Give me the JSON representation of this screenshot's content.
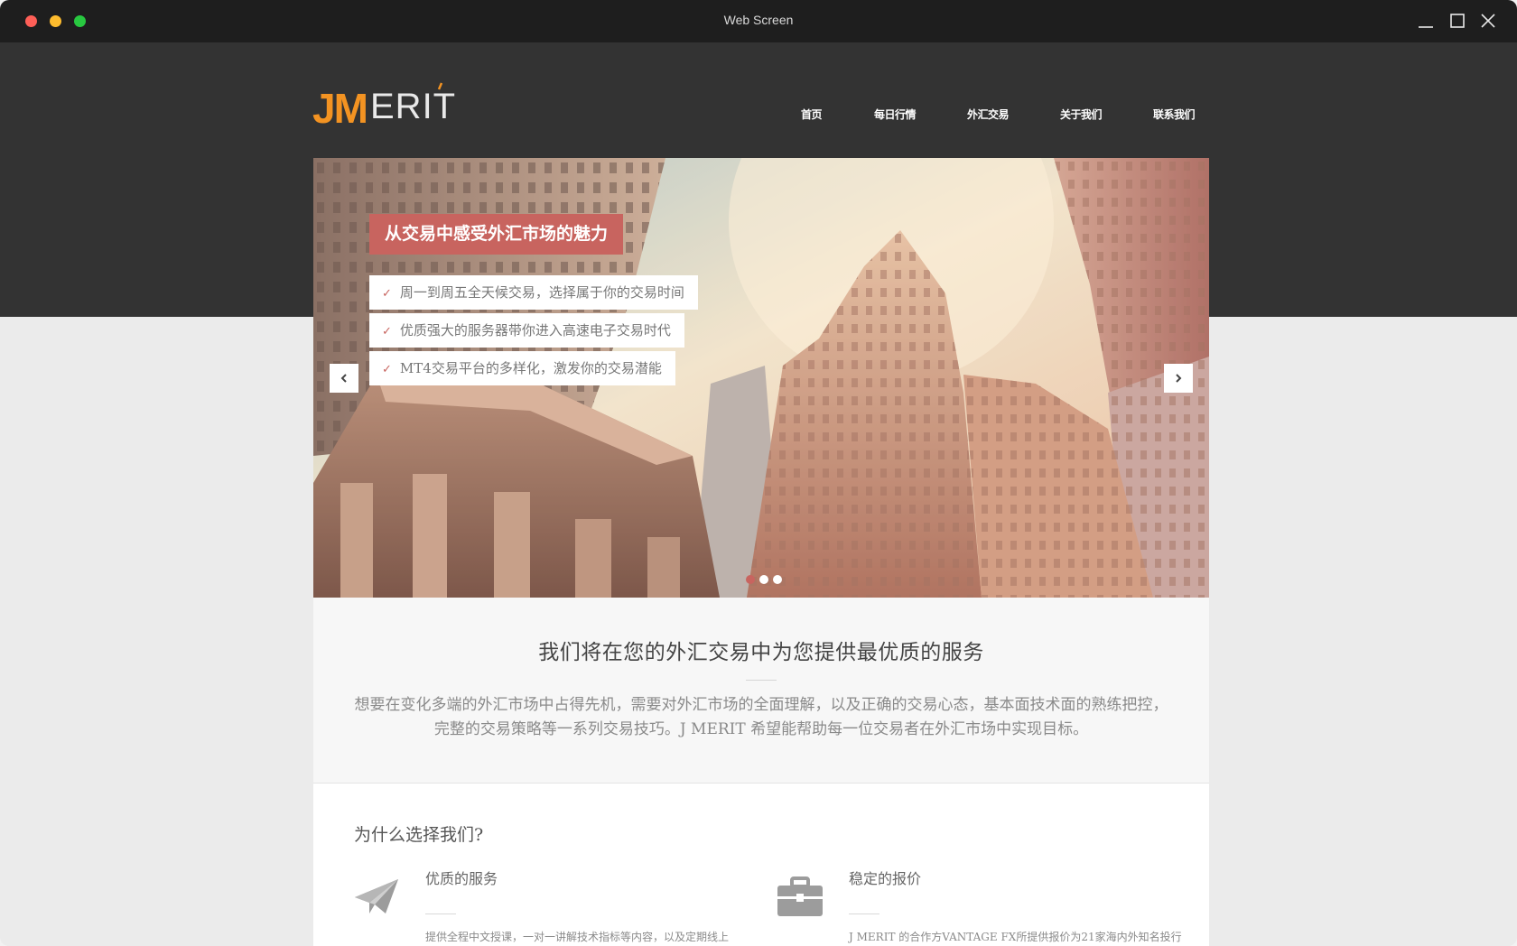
{
  "window": {
    "title": "Web Screen"
  },
  "logo": {
    "text_jm": "JM",
    "text_erit": "ERIT",
    "accent_color": "#f39322"
  },
  "nav": [
    {
      "label": "首页"
    },
    {
      "label": "每日行情"
    },
    {
      "label": "外汇交易"
    },
    {
      "label": "关于我们"
    },
    {
      "label": "联系我们"
    }
  ],
  "slider": {
    "title": "从交易中感受外汇市场的魅力",
    "features": [
      "周一到周五全天候交易，选择属于你的交易时间",
      "优质强大的服务器带你进入高速电子交易时代",
      "MT4交易平台的多样化，激发你的交易潜能"
    ],
    "check_glyph": "✓",
    "prev_icon": "chevron-left-icon",
    "next_icon": "chevron-right-icon",
    "dot_count": 3,
    "active_dot": 1,
    "accent_color": "#c8645f"
  },
  "intro": {
    "heading": "我们将在您的外汇交易中为您提供最优质的服务",
    "paragraph": "想要在变化多端的外汇市场中占得先机，需要对外汇市场的全面理解，以及正确的交易心态，基本面技术面的熟练把控，完整的交易策略等一系列交易技巧。J MERIT 希望能帮助每一位交易者在外汇市场中实现目标。"
  },
  "why": {
    "heading": "为什么选择我们?",
    "items": [
      {
        "icon": "paper-plane-icon",
        "title": "优质的服务",
        "text": "提供全程中文授课，一对一讲解技术指标等内容，以及定期线上"
      },
      {
        "icon": "briefcase-icon",
        "title": "稳定的报价",
        "text": "J MERIT 的合作方VANTAGE FX所提供报价为21家海内外知名投行"
      }
    ]
  },
  "colors": {
    "header_bg": "#333333",
    "page_bg": "#ebebeb",
    "titlebar_bg": "#1e1e1e"
  }
}
